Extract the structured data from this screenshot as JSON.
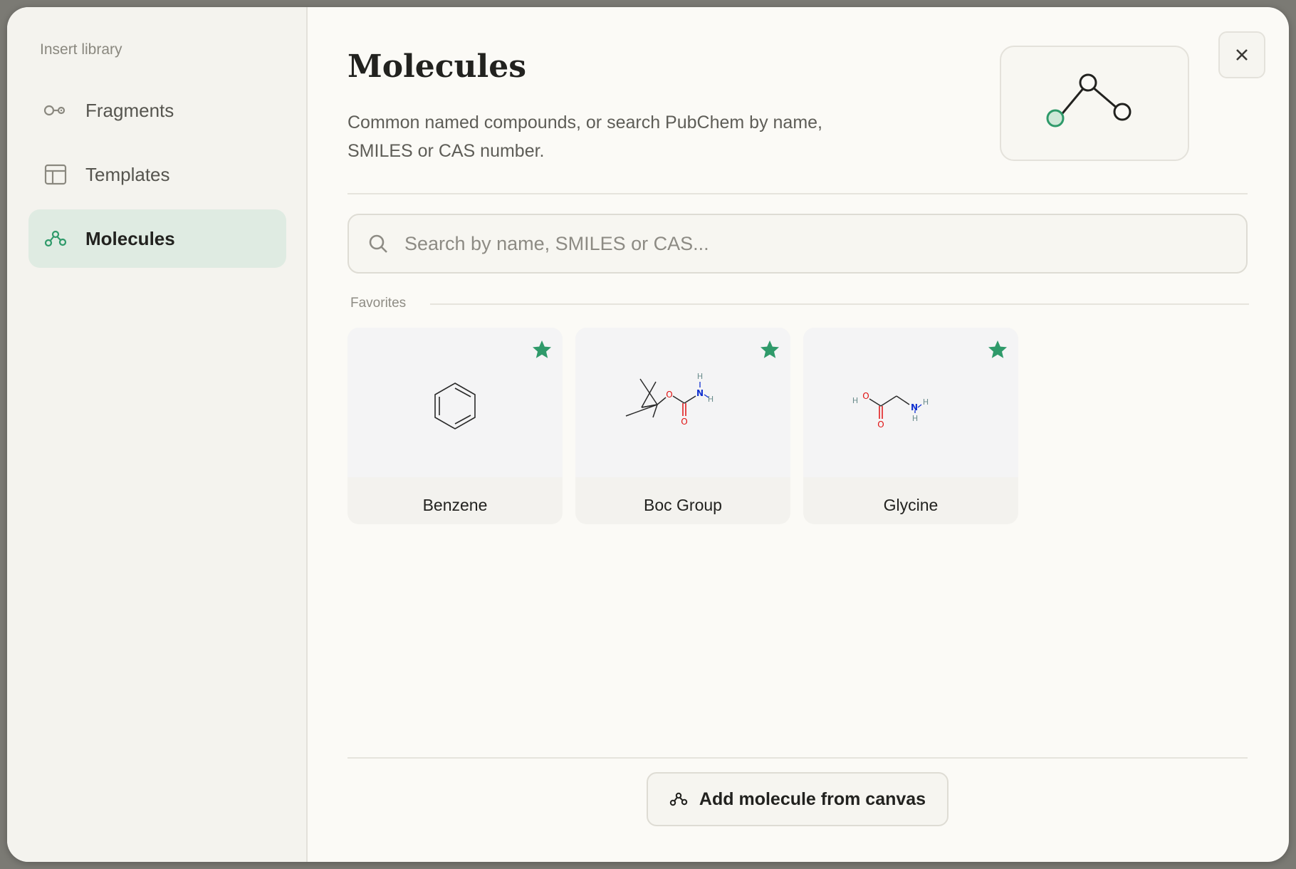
{
  "sidebar": {
    "title": "Insert library",
    "items": [
      {
        "label": "Fragments",
        "icon": "fragment-icon"
      },
      {
        "label": "Templates",
        "icon": "template-icon"
      },
      {
        "label": "Molecules",
        "icon": "molecule-icon",
        "active": true
      }
    ]
  },
  "main": {
    "title": "Molecules",
    "subtitle": "Common named compounds, or search PubChem by name, SMILES or CAS number.",
    "search": {
      "placeholder": "Search by name, SMILES or CAS..."
    },
    "favorites_label": "Favorites",
    "favorites": [
      {
        "name": "Benzene",
        "favorite": true
      },
      {
        "name": "Boc Group",
        "favorite": true,
        "atoms": {
          "o1": "O",
          "n": "N",
          "h1": "H",
          "h2": "H",
          "o2": "O"
        }
      },
      {
        "name": "Glycine",
        "favorite": true,
        "atoms": {
          "h_oh": "H",
          "o1": "O",
          "o2": "O",
          "n": "N",
          "h1": "H",
          "h2": "H"
        }
      }
    ],
    "add_button_label": "Add molecule from canvas"
  },
  "colors": {
    "accent": "#2f9a6a",
    "active_bg": "#dfebe2",
    "oxygen": "#e01010",
    "nitrogen": "#1030d0",
    "hydrogen": "#6a8c8c"
  }
}
